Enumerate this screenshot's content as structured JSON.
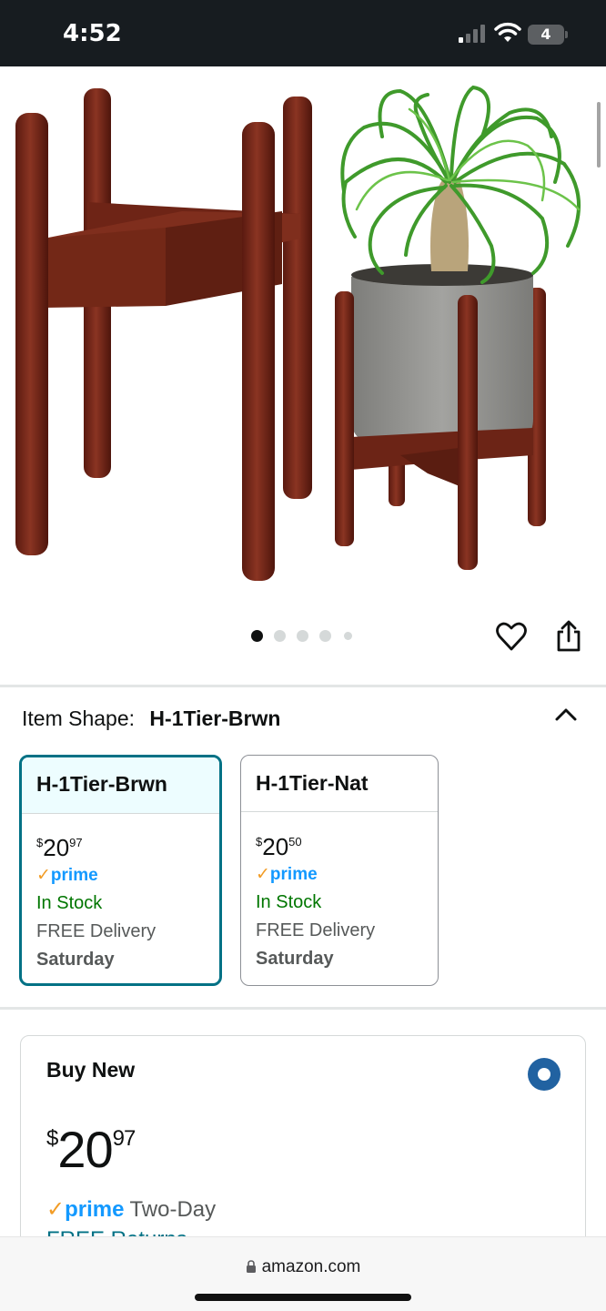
{
  "status_bar": {
    "time": "4:52",
    "battery_level": "4",
    "icons": [
      "signal-icon",
      "wifi-icon",
      "battery-icon"
    ]
  },
  "gallery": {
    "dots_total": 5,
    "active_index": 0,
    "icons": [
      "heart-icon",
      "share-icon"
    ]
  },
  "item_shape": {
    "label": "Item Shape:",
    "selected": "H-1Tier-Brwn",
    "toggle_icon": "chevron-up-icon",
    "options": [
      {
        "name": "H-1Tier-Brwn",
        "price_symbol": "$",
        "price_whole": "20",
        "price_fraction": "97",
        "prime_check": "✓",
        "prime": "prime",
        "stock": "In Stock",
        "delivery": "FREE Delivery",
        "day": "Saturday"
      },
      {
        "name": "H-1Tier-Nat",
        "price_symbol": "$",
        "price_whole": "20",
        "price_fraction": "50",
        "prime_check": "✓",
        "prime": "prime",
        "stock": "In Stock",
        "delivery": "FREE Delivery",
        "day": "Saturday"
      }
    ]
  },
  "buy_new": {
    "title": "Buy New",
    "price_symbol": "$",
    "price_whole": "20",
    "price_fraction": "97",
    "prime_check": "✓",
    "prime": "prime",
    "shipping": "Two-Day",
    "returns": "FREE Returns"
  },
  "browser": {
    "url": "amazon.com"
  },
  "colors": {
    "status_bar_bg": "#171c20",
    "selected_border": "#007185",
    "selected_head_bg": "#edfdff",
    "prime_blue": "#1399ff",
    "prime_check": "#f29c25",
    "in_stock_green": "#007600",
    "radio_blue": "#2162a1",
    "stand_wood": "#7a2b1c",
    "pot_gray": "#8f8f8c"
  }
}
